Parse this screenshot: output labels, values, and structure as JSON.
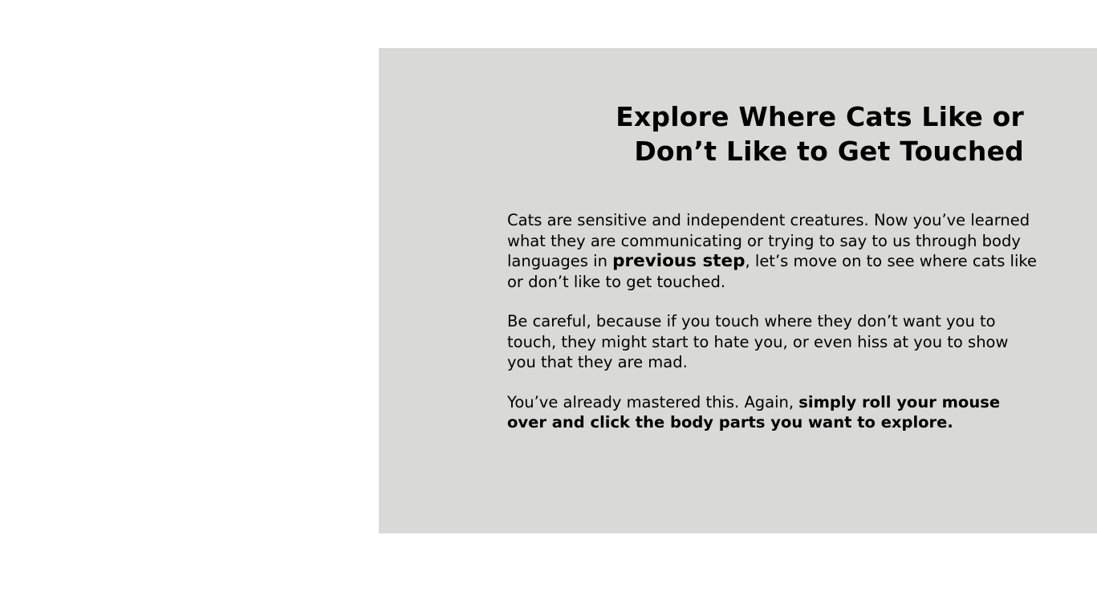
{
  "slide": {
    "title_line1": "Explore Where Cats Like or",
    "title_line2": "Don’t Like to Get Touched",
    "paragraph1": {
      "text_before": "Cats are sensitive and independent creatures. Now you’ve learned what they are communicating or trying to say to us through body languages in ",
      "link_text": "previous step",
      "text_after": ", let’s move on to see where cats like or don’t like to get touched."
    },
    "paragraph2": "Be careful, because if you touch where they don’t want you to touch, they might start to hate you, or even hiss at you to show you that they are mad.",
    "paragraph3": {
      "text_before": "You’ve already mastered this. Again, ",
      "bold_text": "simply roll your mouse over and click the body parts you want to explore."
    }
  },
  "colors": {
    "panel_background": "#d9d9d8",
    "page_background": "#ffffff",
    "text": "#000000"
  }
}
